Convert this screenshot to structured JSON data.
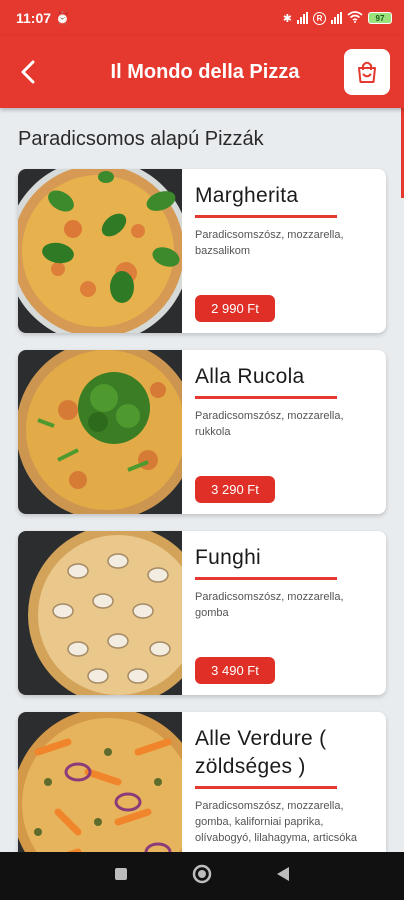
{
  "status": {
    "time": "11:07",
    "battery": "97"
  },
  "header": {
    "title": "Il Mondo della Pizza"
  },
  "section_title": "Paradicsomos alapú Pizzák",
  "pizzas": [
    {
      "name": "Margherita",
      "description": "Paradicsomszósz, mozzarella, bazsalikom",
      "price": "2 990 Ft",
      "topping": "basil"
    },
    {
      "name": "Alla Rucola",
      "description": "Paradicsomszósz, mozzarella, rukkola",
      "price": "3 290 Ft",
      "topping": "arugula"
    },
    {
      "name": "Funghi",
      "description": "Paradicsomszósz, mozzarella, gomba",
      "price": "3 490 Ft",
      "topping": "mushroom"
    },
    {
      "name": "Alle Verdure ( zöldséges )",
      "description": "Paradicsomszósz, mozzarella, gomba, kaliforniai paprika, olívabogyó, lilahagyma, articsóka",
      "price": "",
      "topping": "vegetables"
    }
  ],
  "colors": {
    "brand_red": "#e5382e",
    "background": "#e9ecef"
  }
}
